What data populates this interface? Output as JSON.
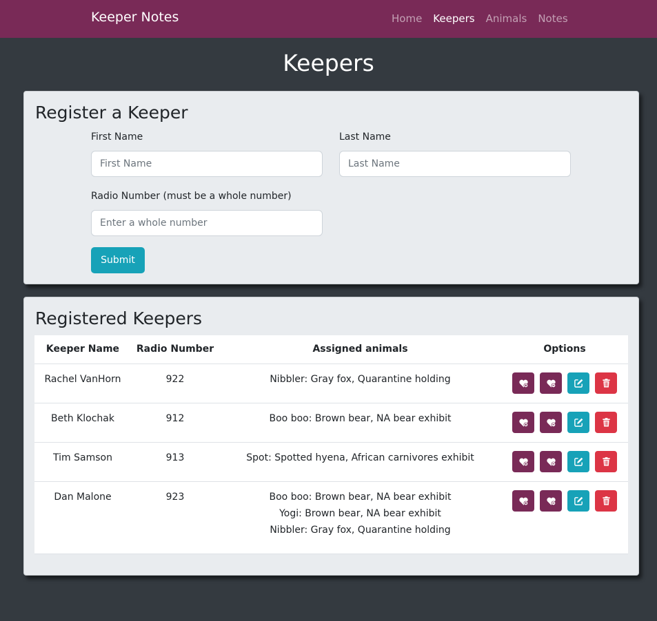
{
  "nav": {
    "brand": "Keeper Notes",
    "links": [
      "Home",
      "Keepers",
      "Animals",
      "Notes"
    ],
    "active": "Keepers"
  },
  "page": {
    "title": "Keepers"
  },
  "register": {
    "title": "Register a Keeper",
    "first_name_label": "First Name",
    "first_name_placeholder": "First Name",
    "first_name_value": "",
    "last_name_label": "Last Name",
    "last_name_placeholder": "Last Name",
    "last_name_value": "",
    "radio_label": "Radio Number (must be a whole number)",
    "radio_placeholder": "Enter a whole number",
    "radio_value": "",
    "submit_label": "Submit"
  },
  "registered": {
    "title": "Registered Keepers",
    "columns": [
      "Keeper Name",
      "Radio Number",
      "Assigned animals",
      "Options"
    ],
    "rows": [
      {
        "name": "Rachel VanHorn",
        "radio": "922",
        "animals": [
          "Nibbler: Gray fox, Quarantine holding"
        ]
      },
      {
        "name": "Beth Klochak",
        "radio": "912",
        "animals": [
          "Boo boo: Brown bear, NA bear exhibit"
        ]
      },
      {
        "name": "Tim Samson",
        "radio": "913",
        "animals": [
          "Spot: Spotted hyena, African carnivores exhibit"
        ]
      },
      {
        "name": "Dan Malone",
        "radio": "923",
        "animals": [
          "Boo boo: Brown bear, NA bear exhibit",
          "Yogi: Brown bear, NA bear exhibit",
          "Nibbler: Gray fox, Quarantine holding"
        ]
      }
    ],
    "option_icons": [
      "heart-plus-icon",
      "heart-minus-icon",
      "edit-icon",
      "trash-icon"
    ]
  },
  "colors": {
    "brand": "#792a57",
    "background": "#343a40",
    "card": "#e9ecef",
    "info": "#17a2b8",
    "danger": "#dc3545"
  }
}
